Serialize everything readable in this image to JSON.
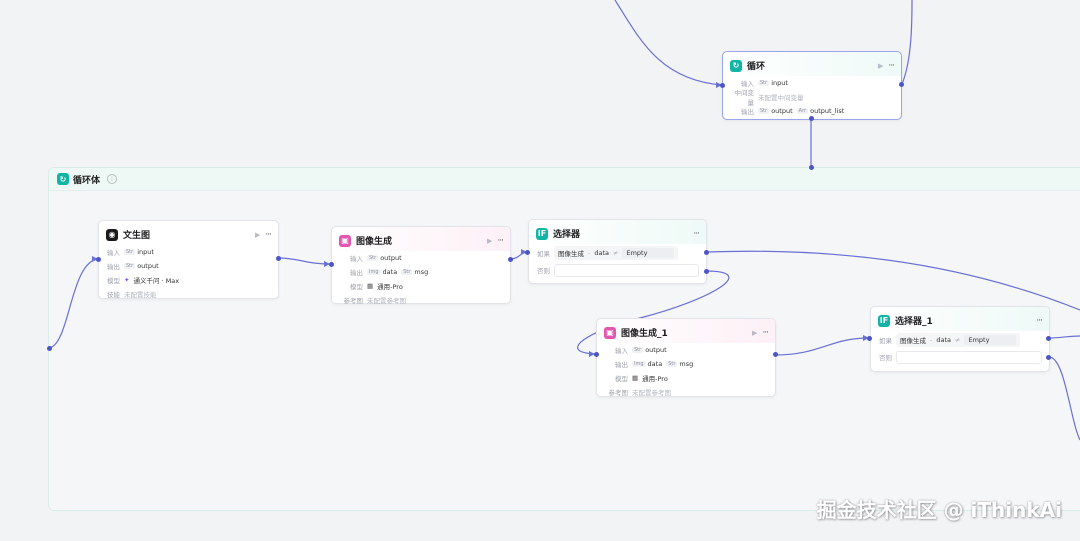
{
  "colors": {
    "edge": "#6a6fd6",
    "port": "#4b55c8",
    "teal": "#12b5a5",
    "pink": "#e255b0"
  },
  "loop_node": {
    "title": "循环",
    "icon": "loop-icon",
    "run_icon": "▶",
    "more": "···",
    "input_label": "输入",
    "input_type": "Str",
    "input_value": "input",
    "var_label": "中间变量",
    "var_value": "未配置中间变量",
    "output_label": "输出",
    "output_type1": "Str",
    "output_value1": "output",
    "output_type2": "Arr",
    "output_value2": "output_list"
  },
  "loop_body": {
    "title": "循环体",
    "icon": "loop-icon"
  },
  "wenshengtu": {
    "title": "文生图",
    "icon": "image-gen-icon",
    "run_icon": "▶",
    "more": "···",
    "input_label": "输入",
    "input_type": "Str",
    "input_value": "input",
    "output_label": "输出",
    "output_type": "Str",
    "output_value": "output",
    "model_label": "模型",
    "model_value": "通义千问 · Max",
    "skill_label": "技能",
    "skill_value": "未配置技能"
  },
  "imggen": {
    "title": "图像生成",
    "run_icon": "▶",
    "more": "···",
    "input_label": "输入",
    "input_type": "Str",
    "input_value": "output",
    "output_label": "输出",
    "output_type1": "Img",
    "output_value1": "data",
    "output_type2": "Str",
    "output_value2": "msg",
    "model_label": "模型",
    "model_value": "通用-Pro",
    "ref_label": "参考图",
    "ref_value": "未配置参考图"
  },
  "selector": {
    "title": "选择器",
    "badge": "IF",
    "more": "···",
    "if_label": "如果",
    "cond_var": "图像生成",
    "cond_field": "data",
    "cond_op": "≠",
    "cond_value": "Empty",
    "else_label": "否则"
  },
  "imggen1": {
    "title": "图像生成_1",
    "run_icon": "▶",
    "more": "···",
    "input_label": "输入",
    "input_type": "Str",
    "input_value": "output",
    "output_label": "输出",
    "output_type1": "Img",
    "output_value1": "data",
    "output_type2": "Str",
    "output_value2": "msg",
    "model_label": "模型",
    "model_value": "通用-Pro",
    "ref_label": "参考图",
    "ref_value": "未配置参考图"
  },
  "selector1": {
    "title": "选择器_1",
    "badge": "IF",
    "more": "···",
    "if_label": "如果",
    "cond_var": "图像生成",
    "cond_field": "data",
    "cond_op": "≠",
    "cond_value": "Empty",
    "else_label": "否则"
  },
  "watermark": "掘金技术社区 @ iThinkAi"
}
